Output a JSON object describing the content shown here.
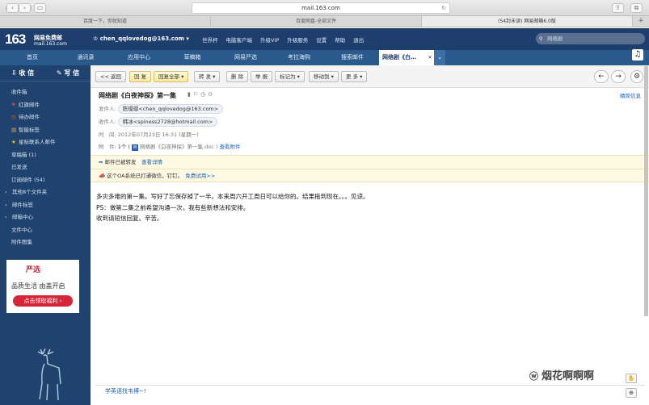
{
  "browser": {
    "url": "mail.163.com",
    "tabs": [
      "百度一下，你就知道",
      "百度网盘-全部文件",
      "(54封未读) 网易邮箱6.0版"
    ]
  },
  "header": {
    "logo_num": "163",
    "logo_brand": "网易免费邮",
    "logo_sub": "mail.163.com",
    "user": "chen_qqlovedog@163.com",
    "links": [
      "世界杯",
      "电脑客户端",
      "升级VIP",
      "升级服务",
      "设置",
      "帮助",
      "退出"
    ],
    "search_placeholder": "网络剧"
  },
  "nav": {
    "items": [
      "首页",
      "通讯录",
      "应用中心",
      "草稿箱",
      "网易严选",
      "考拉海购",
      "搜索邮件"
    ],
    "current": "网络剧《白…"
  },
  "sidebar": {
    "receive": "收 信",
    "write": "写 信",
    "folders": [
      {
        "label": "收件箱",
        "icon": ""
      },
      {
        "label": "红旗邮件",
        "icon": "flag-icon"
      },
      {
        "label": "待办邮件",
        "icon": "clock-icon"
      },
      {
        "label": "智能标签",
        "icon": "tag-icon"
      },
      {
        "label": "星标联系人邮件",
        "icon": "star-icon"
      },
      {
        "label": "草稿箱 (1)",
        "icon": ""
      },
      {
        "label": "已发送",
        "icon": ""
      },
      {
        "label": "订阅邮件 (54)",
        "icon": ""
      },
      {
        "label": "其他8个文件夹",
        "icon": "expand-icon"
      },
      {
        "label": "邮件标签",
        "icon": "expand-icon"
      },
      {
        "label": "邮箱中心",
        "icon": "expand-icon"
      },
      {
        "label": "文件中心",
        "icon": ""
      },
      {
        "label": "附件图集",
        "icon": ""
      }
    ],
    "ad": {
      "brand": "严选",
      "tagline": "品质生活 由盖开启",
      "button": "点击领取福利 ›"
    }
  },
  "toolbar": {
    "back": "<< 返回",
    "reply": "回 复",
    "reply_all": "回复全部",
    "forward": "转 发",
    "delete": "删 除",
    "report": "举 报",
    "mark_as": "标记为",
    "move_to": "移动到",
    "more": "更 多"
  },
  "mail": {
    "subject": "网络剧《白夜神探》第一集",
    "compact": "精简信息",
    "from_label": "发件人:",
    "from": "陈璟璟<chen_qqlovedog@163.com>",
    "to_label": "收件人:",
    "to": "韩冰<spiness2728@hotmail.com>",
    "time_label": "时　间:",
    "time": "2012年07月23日 16:31 (星期一)",
    "attach_label": "附　件:",
    "attach_count": "1个 (",
    "attach_name": "网络剧《白夜神探》第一集.doc )",
    "attach_view": "查看附件",
    "forwarded": "邮件已被转发",
    "forwarded_link": "查看详情",
    "oa_notice": "这个OA系统已打通微信，钉钉。",
    "oa_link": "免费试用>>",
    "body": [
      "多灾多难的第一集。写好了忘保存掉了一半。本来周六开工周日可以给你的。结果拖到现在。。。见谅。",
      "PS：做第二集之前希望沟通一次，我有些新想法和安排。",
      "收到请短信回复。辛苦。"
    ]
  },
  "footer": {
    "link": "学英语找韦博~!"
  },
  "watermark": "烟花啊啊啊"
}
